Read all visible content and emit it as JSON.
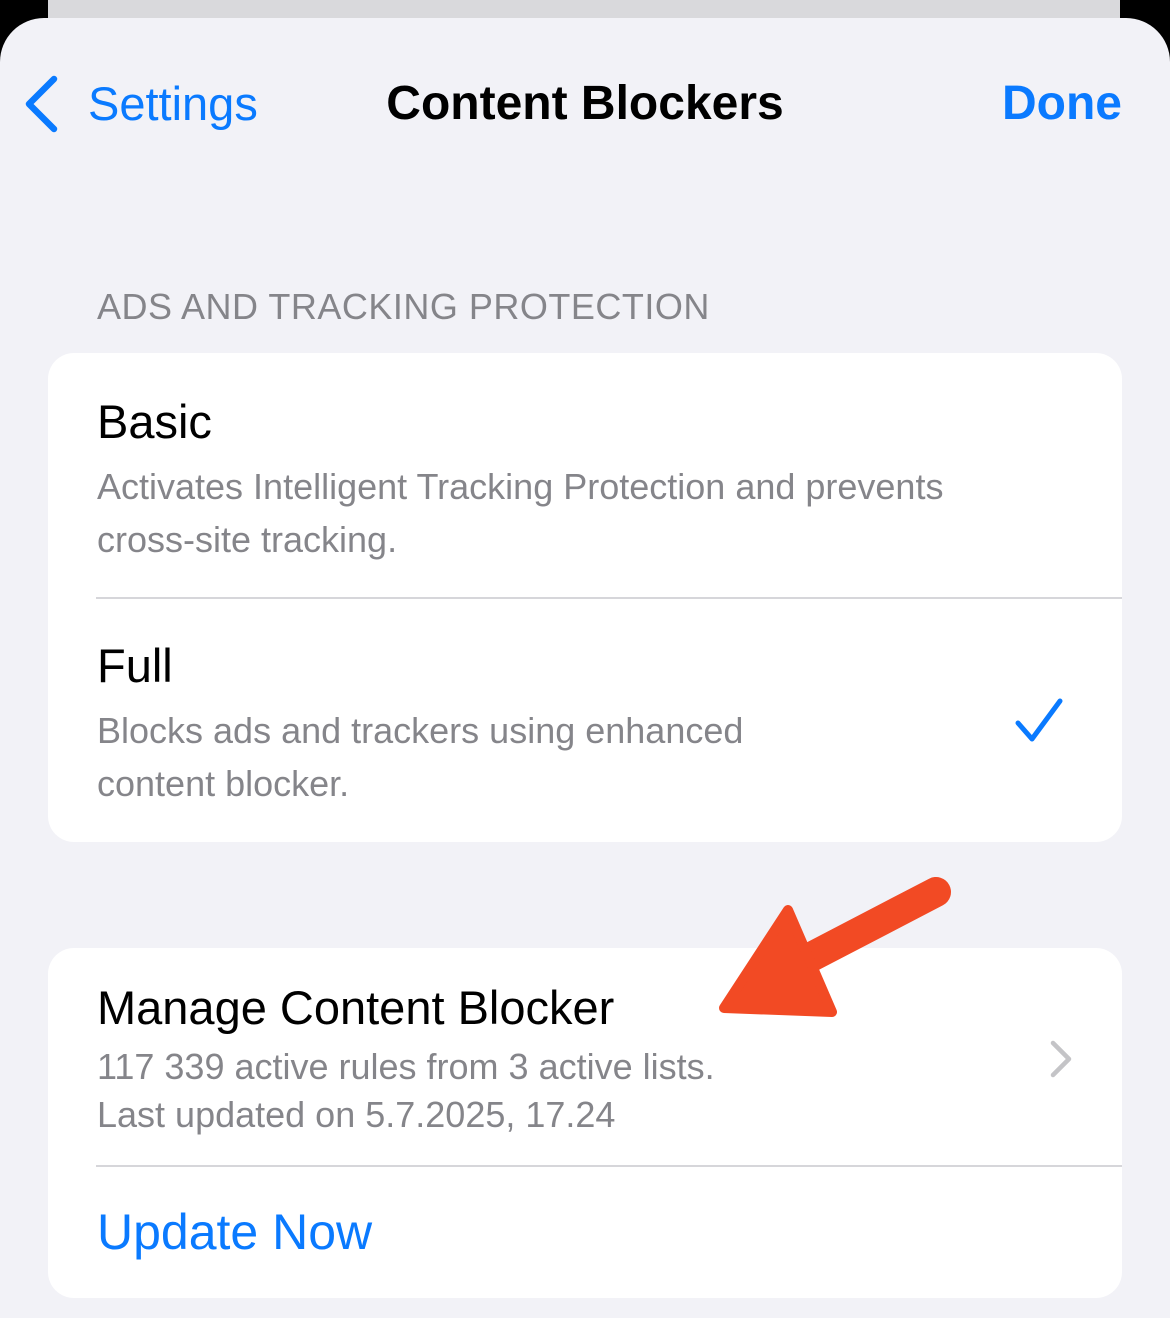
{
  "nav": {
    "back_label": "Settings",
    "title": "Content Blockers",
    "done_label": "Done"
  },
  "section_header": "ADS AND TRACKING PROTECTION",
  "protection_options": [
    {
      "title": "Basic",
      "subtitle_lines": [
        "Activates Intelligent Tracking Protection and prevents",
        "cross-site tracking."
      ],
      "selected": false
    },
    {
      "title": "Full",
      "subtitle_lines": [
        "Blocks ads and trackers using enhanced",
        "content blocker."
      ],
      "selected": true
    }
  ],
  "manage": {
    "title": "Manage Content Blocker",
    "subtitle_lines": [
      "117 339 active rules from 3 active lists.",
      "Last updated on 5.7.2025, 17.24"
    ],
    "update_label": "Update Now"
  },
  "colors": {
    "accent": "#0a7aff",
    "annotation_arrow": "#f24a24",
    "background": "#f2f2f7",
    "secondary_text": "#85858a"
  },
  "icons": {
    "back": "chevron-left-icon",
    "selected": "checkmark-icon",
    "disclosure": "chevron-right-icon",
    "annotation": "red-arrow-annotation"
  }
}
